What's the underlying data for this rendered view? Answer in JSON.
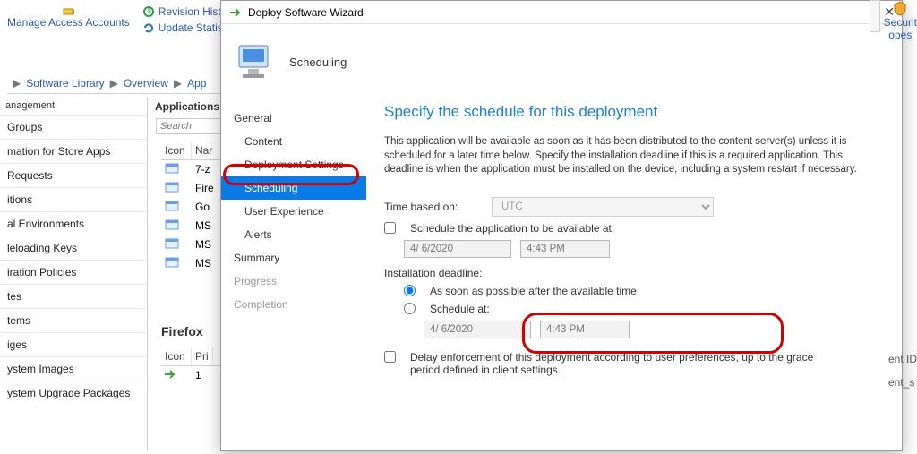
{
  "toolbar": {
    "manage_access": "Manage Access Accounts",
    "revision_history": "Revision History",
    "update_statistics": "Update Statistics",
    "security": "Securit",
    "scopes": "opes"
  },
  "breadcrumb": {
    "a": "Software Library",
    "b": "Overview",
    "c": "App"
  },
  "left_sections": {
    "title": "anagement",
    "items": [
      "Groups",
      "mation for Store Apps",
      "Requests",
      "itions",
      "al Environments",
      "leloading Keys",
      "iration Policies",
      "tes",
      "tems",
      "iges",
      "ystem Images",
      "ystem Upgrade Packages"
    ]
  },
  "mid": {
    "panel_title": "Applications",
    "search_placeholder": "Search",
    "columns": {
      "icon": "Icon",
      "name": "Nar"
    },
    "rows": [
      "7-z",
      "Fire",
      "Go",
      "MS",
      "MS",
      "MS"
    ]
  },
  "detail": {
    "title": "Firefox",
    "columns": {
      "icon": "Icon",
      "priority": "Pri"
    },
    "row": {
      "icon": "",
      "priority": "1"
    },
    "right_cols": {
      "id": "ent ID",
      "user": "ent_s"
    }
  },
  "wizard": {
    "title": "Deploy Software Wizard",
    "banner": "Scheduling",
    "nav": [
      "General",
      "Content",
      "Deployment Settings",
      "Scheduling",
      "User Experience",
      "Alerts",
      "Summary",
      "Progress",
      "Completion"
    ],
    "content": {
      "heading": "Specify the schedule for this deployment",
      "desc": "This application will be available as soon as it has been distributed to the content server(s) unless it is scheduled for a later time below. Specify the installation deadline if this is a required application. This deadline is when the application must be installed on the device, including a system restart if necessary.",
      "time_based_label": "Time based on:",
      "time_based_value": "UTC",
      "schedule_available_label": "Schedule the application to be available at:",
      "date_value": "4/ 6/2020",
      "time_value": "4:43 PM",
      "install_deadline_label": "Installation deadline:",
      "radio_asap": "As soon as possible after the available time",
      "radio_schedule_at": "Schedule at:",
      "delay_label": "Delay enforcement of this deployment according to user preferences, up to the grace period defined in client settings."
    }
  }
}
